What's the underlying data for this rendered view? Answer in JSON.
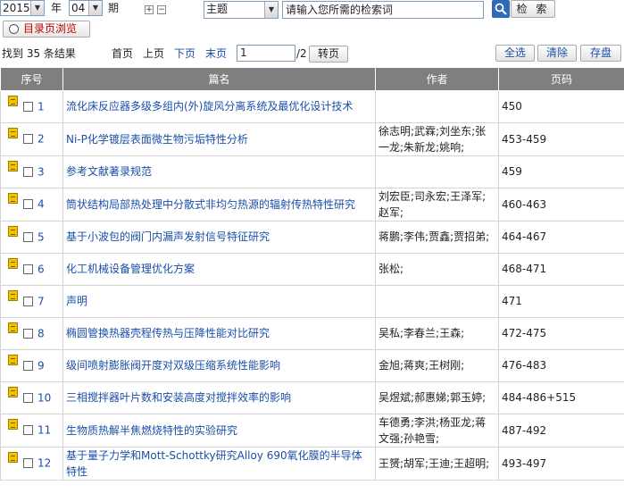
{
  "search": {
    "year": "2015",
    "year_unit": "年",
    "issue": "04",
    "issue_unit": "期",
    "field": "主题",
    "query_value": "请输入您所需的检索词",
    "search_label": "检 索",
    "directory_label": "目录页浏览"
  },
  "results": {
    "count_text": "找到 35 条结果",
    "first": "首页",
    "prev": "上页",
    "next": "下页",
    "last": "末页",
    "page_value": "1",
    "page_total": "/2",
    "jump": "转页",
    "select_all": "全选",
    "clear": "清除",
    "save": "存盘"
  },
  "table": {
    "headers": [
      "序号",
      "篇名",
      "作者",
      "页码"
    ],
    "rows": [
      {
        "no": "1",
        "title": "流化床反应器多级多组内(外)旋风分离系统及最优化设计技术",
        "authors": "",
        "pages": "450"
      },
      {
        "no": "2",
        "title": "Ni-P化学镀层表面微生物污垢特性分析",
        "authors": "徐志明;武霖;刘坐东;张一龙;朱新龙;姚响;",
        "pages": "453-459"
      },
      {
        "no": "3",
        "title": "参考文献著录规范",
        "authors": "",
        "pages": "459"
      },
      {
        "no": "4",
        "title": "筒状结构局部热处理中分散式非均匀热源的辐射传热特性研究",
        "authors": "刘宏臣;司永宏;王泽军;赵军;",
        "pages": "460-463"
      },
      {
        "no": "5",
        "title": "基于小波包的阀门内漏声发射信号特征研究",
        "authors": "蒋鹏;李伟;贾鑫;贾招弟;",
        "pages": "464-467"
      },
      {
        "no": "6",
        "title": "化工机械设备管理优化方案",
        "authors": "张松;",
        "pages": "468-471"
      },
      {
        "no": "7",
        "title": "声明",
        "authors": "",
        "pages": "471"
      },
      {
        "no": "8",
        "title": "椭圆管换热器壳程传热与压降性能对比研究",
        "authors": "吴私;李春兰;王森;",
        "pages": "472-475"
      },
      {
        "no": "9",
        "title": "级间喷射膨胀阀开度对双级压缩系统性能影响",
        "authors": "金旭;蒋爽;王树刚;",
        "pages": "476-483"
      },
      {
        "no": "10",
        "title": "三相搅拌器叶片数和安装高度对搅拌效率的影响",
        "authors": "吴煜斌;郝惠娣;郭玉婷;",
        "pages": "484-486+515"
      },
      {
        "no": "11",
        "title": "生物质热解半焦燃烧特性的实验研究",
        "authors": "车德勇;李洪;杨亚龙;蒋文强;孙艳雪;",
        "pages": "487-492"
      },
      {
        "no": "12",
        "title": "基于量子力学和Mott-Schottky研究Alloy 690氧化膜的半导体特性",
        "authors": "王赟;胡军;王迪;王超明;",
        "pages": "493-497"
      }
    ]
  }
}
